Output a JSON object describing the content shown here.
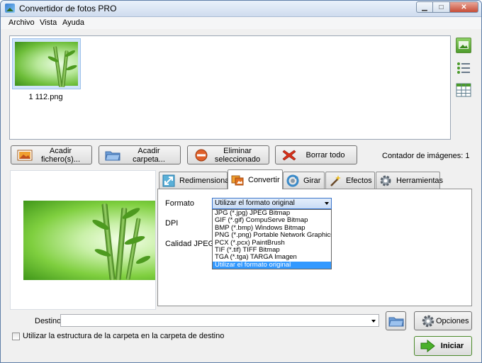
{
  "window": {
    "title": "Convertidor de fotos PRO"
  },
  "menu": [
    "Archivo",
    "Vista",
    "Ayuda"
  ],
  "files": [
    {
      "name": "1 112.png"
    }
  ],
  "toolbar": {
    "add_files": "Acadir fichero(s)...",
    "add_folder": "Acadir carpeta...",
    "remove_selected": "Eliminar seleccionado",
    "clear_all": "Borrar todo",
    "counter_label": "Contador de imágenes: 1"
  },
  "tabs": [
    {
      "label": "Redimensionar",
      "icon": "resize-icon"
    },
    {
      "label": "Convertir",
      "icon": "convert-icon",
      "active": true
    },
    {
      "label": "Girar",
      "icon": "rotate-icon"
    },
    {
      "label": "Efectos",
      "icon": "effects-wand-icon"
    },
    {
      "label": "Herramientas",
      "icon": "tools-gear-icon"
    }
  ],
  "convert": {
    "format_label": "Formato",
    "dpi_label": "DPI",
    "jpeg_quality_label": "Calidad JPEG",
    "selected_format": "Utilizar el formato original",
    "format_options": [
      "JPG (*.jpg) JPEG Bitmap",
      "GIF (*.gif) CompuServe Bitmap",
      "BMP (*.bmp) Windows Bitmap",
      "PNG (*.png) Portable Network Graphics",
      "PCX (*.pcx) PaintBrush",
      "TIF (*.tif) TIFF Bitmap",
      "TGA (*.tga) TARGA Imagen",
      "Utilizar el formato original"
    ]
  },
  "destination": {
    "label": "Destino",
    "value": "",
    "options_button": "Opciones",
    "keep_structure_label": "Utilizar la estructura de la carpeta en la carpeta de destino",
    "keep_structure_checked": false,
    "start_button": "Iniciar"
  },
  "colors": {
    "accent": "#3399ff",
    "select_border": "#3a73c9"
  }
}
